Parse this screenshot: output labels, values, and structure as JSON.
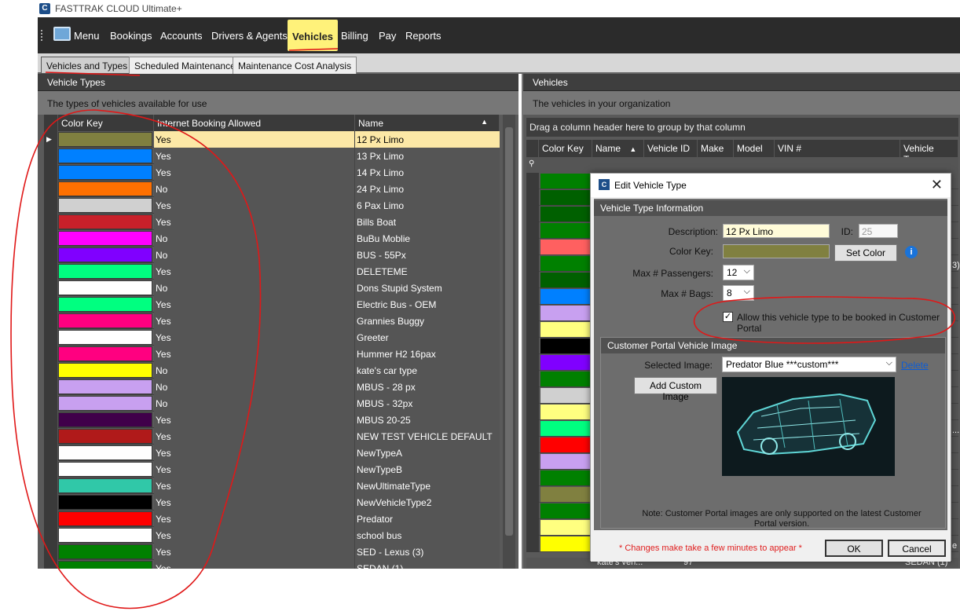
{
  "app": {
    "title": "FASTTRAK CLOUD Ultimate+"
  },
  "menu": {
    "menu_label": "Menu",
    "items": [
      "Bookings",
      "Accounts",
      "Drivers & Agents",
      "Vehicles",
      "Billing",
      "Pay",
      "Reports"
    ]
  },
  "tabs": [
    "Vehicles and Types",
    "Scheduled Maintenance",
    "Maintenance Cost Analysis"
  ],
  "left": {
    "header": "Vehicle Types",
    "description": "The types of vehicles available for use",
    "columns": [
      "Color Key",
      "Internet Booking Allowed",
      "Name"
    ],
    "sort_icon": "sort-up-icon",
    "rows": [
      {
        "color": "#808040",
        "ib": "Yes",
        "name": "12 Px Limo"
      },
      {
        "color": "#0080ff",
        "ib": "Yes",
        "name": "13 Px Limo"
      },
      {
        "color": "#0080ff",
        "ib": "Yes",
        "name": "14 Px Limo"
      },
      {
        "color": "#ff7000",
        "ib": "No",
        "name": "24 Px Limo"
      },
      {
        "color": "#d0d0d0",
        "ib": "Yes",
        "name": "6 Pax Limo"
      },
      {
        "color": "#c8202a",
        "ib": "Yes",
        "name": "Bills Boat"
      },
      {
        "color": "#ff00ff",
        "ib": "No",
        "name": "BuBu Moblie"
      },
      {
        "color": "#8000ff",
        "ib": "No",
        "name": "BUS - 55Px"
      },
      {
        "color": "#00ff80",
        "ib": "Yes",
        "name": "DELETEME"
      },
      {
        "color": "#ffffff",
        "ib": "No",
        "name": "Dons Stupid System"
      },
      {
        "color": "#00ff80",
        "ib": "Yes",
        "name": "Electric Bus - OEM"
      },
      {
        "color": "#ff0080",
        "ib": "Yes",
        "name": "Grannies Buggy"
      },
      {
        "color": "#ffffff",
        "ib": "Yes",
        "name": "Greeter"
      },
      {
        "color": "#ff0080",
        "ib": "Yes",
        "name": "Hummer H2 16pax"
      },
      {
        "color": "#ffff00",
        "ib": "No",
        "name": "kate's car type"
      },
      {
        "color": "#c8a0f0",
        "ib": "No",
        "name": "MBUS - 28 px"
      },
      {
        "color": "#c8a0f0",
        "ib": "No",
        "name": "MBUS - 32px"
      },
      {
        "color": "#40004a",
        "ib": "Yes",
        "name": "MBUS 20-25"
      },
      {
        "color": "#b01a1a",
        "ib": "Yes",
        "name": "NEW TEST VEHICLE DEFAULT"
      },
      {
        "color": "#ffffff",
        "ib": "Yes",
        "name": "NewTypeA"
      },
      {
        "color": "#ffffff",
        "ib": "Yes",
        "name": "NewTypeB"
      },
      {
        "color": "#30c8a8",
        "ib": "Yes",
        "name": "NewUltimateType"
      },
      {
        "color": "#000000",
        "ib": "Yes",
        "name": "NewVehicleType2"
      },
      {
        "color": "#ff0000",
        "ib": "Yes",
        "name": "Predator"
      },
      {
        "color": "#ffffff",
        "ib": "Yes",
        "name": "school bus"
      },
      {
        "color": "#008000",
        "ib": "Yes",
        "name": "SED - Lexus (3)"
      },
      {
        "color": "#008000",
        "ib": "Yes",
        "name": "SEDAN (1)"
      }
    ]
  },
  "right": {
    "header": "Vehicles",
    "description": "The vehicles in your organization",
    "group_hint": "Drag a column header here to group by that column",
    "columns": [
      "Color Key",
      "Name",
      "Vehicle ID",
      "Make",
      "Model",
      "VIN #",
      "Vehicle Type"
    ],
    "filter_icon": "filter-icon",
    "row_colors": [
      "#008000",
      "#006000",
      "#006000",
      "#008000",
      "#ff6060",
      "#008000",
      "#006000",
      "#0080ff",
      "#c8a0f0",
      "#ffff80",
      "#000000",
      "#8000ff",
      "#008000",
      "#d0d0d0",
      "#ffff80",
      "#00ff80",
      "#ff0000",
      "#c8a0f0",
      "#008000",
      "#808040",
      "#008000",
      "#ffff80",
      "#ffff00"
    ],
    "peek_right": [
      "3)",
      "...",
      "e"
    ],
    "last_row": {
      "name": "kate's ven...",
      "vehicle_id": "97",
      "vehicle_type": "SEDAN (1)"
    }
  },
  "dialog": {
    "title": "Edit Vehicle Type",
    "section1": "Vehicle Type Information",
    "description_label": "Description:",
    "description_value": "12 Px Limo",
    "id_label": "ID:",
    "id_value": "25",
    "color_key_label": "Color Key:",
    "color_key_value": "#808040",
    "set_color_label": "Set Color",
    "max_pax_label": "Max # Passengers:",
    "max_pax_value": "12",
    "max_bags_label": "Max # Bags:",
    "max_bags_value": "8",
    "allow_label": "Allow this vehicle type to be booked in Customer Portal",
    "allow_checked": true,
    "section2": "Customer Portal Vehicle Image",
    "selected_image_label": "Selected Image:",
    "selected_image_value": "Predator Blue   ***custom***",
    "delete_label": "Delete",
    "add_custom_label": "Add Custom Image",
    "note": "Note: Customer Portal images are only supported on the latest Customer Portal version.",
    "changes_note": "* Changes make take a few minutes to appear *",
    "ok_label": "OK",
    "cancel_label": "Cancel"
  }
}
